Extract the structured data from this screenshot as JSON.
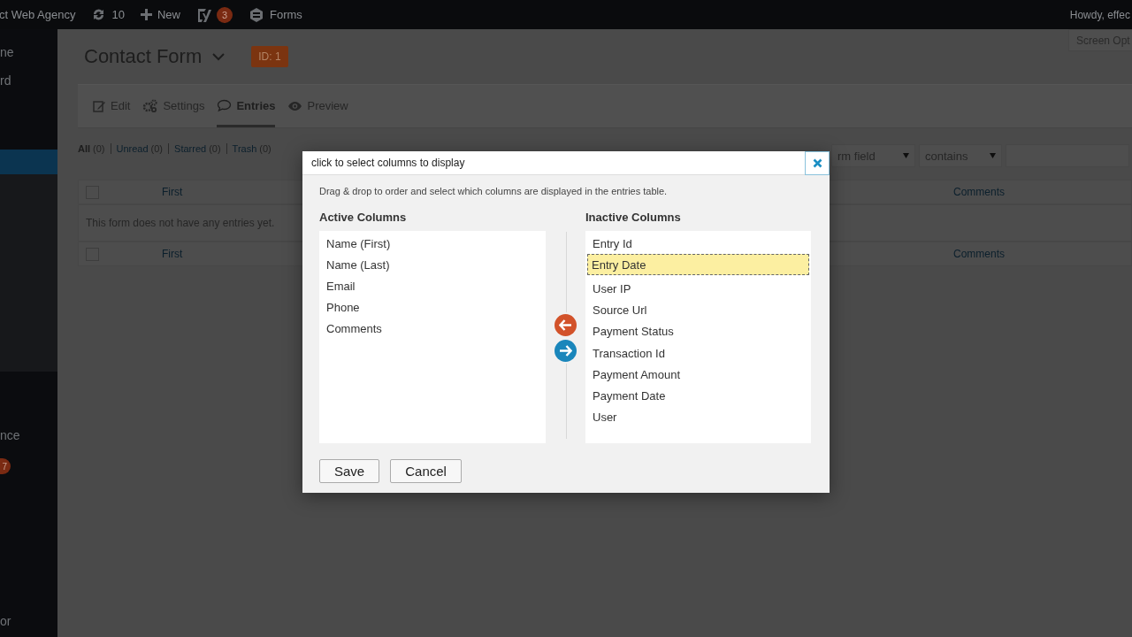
{
  "admin_bar": {
    "site": "ct Web Agency",
    "updates": "10",
    "new": "New",
    "seo_badge": "3",
    "forms": "Forms",
    "greeting": "Howdy, effec"
  },
  "sidebar": {
    "items": [
      {
        "kind": "text",
        "label": "ne"
      },
      {
        "kind": "text",
        "label": "rd"
      },
      {
        "kind": "current",
        "selected": true
      },
      {
        "kind": "submenu"
      },
      {
        "kind": "text",
        "label": "nce"
      },
      {
        "kind": "badge",
        "label": "7"
      },
      {
        "kind": "text",
        "label": "or"
      }
    ]
  },
  "screen_options": "Screen Opt",
  "page": {
    "title": "Contact Form",
    "id_badge": "ID: 1"
  },
  "tabs": [
    {
      "label": "Edit",
      "selected": false
    },
    {
      "label": "Settings",
      "selected": false
    },
    {
      "label": "Entries",
      "selected": true
    },
    {
      "label": "Preview",
      "selected": false
    }
  ],
  "filters": [
    {
      "label": "All",
      "count": "(0)",
      "selected": true
    },
    {
      "label": "Unread",
      "count": "(0)",
      "selected": false
    },
    {
      "label": "Starred",
      "count": "(0)",
      "selected": false
    },
    {
      "label": "Trash",
      "count": "(0)",
      "selected": false
    }
  ],
  "search": {
    "field": "rm field",
    "operator": "contains"
  },
  "table": {
    "header": {
      "checked": false,
      "columns": [
        "First",
        "Comments"
      ]
    },
    "empty_message": "This form does not have any entries yet.",
    "footer": {
      "checked": false,
      "columns": [
        "First",
        "Comments"
      ]
    }
  },
  "dialog": {
    "title": "click to select columns to display",
    "description": "Drag & drop to order and select which columns are displayed in the entries table.",
    "active_heading": "Active Columns",
    "inactive_heading": "Inactive Columns",
    "active_columns": [
      {
        "label": "Name (First)",
        "selected": false
      },
      {
        "label": "Name (Last)",
        "selected": false
      },
      {
        "label": "Email",
        "selected": false
      },
      {
        "label": "Phone",
        "selected": false
      },
      {
        "label": "Comments",
        "selected": false
      }
    ],
    "inactive_columns": [
      {
        "label": "Entry Id",
        "selected": false
      },
      {
        "label": "Entry Date",
        "selected": true
      },
      {
        "label": "User IP",
        "selected": false
      },
      {
        "label": "Source Url",
        "selected": false
      },
      {
        "label": "Payment Status",
        "selected": false
      },
      {
        "label": "Transaction Id",
        "selected": false
      },
      {
        "label": "Payment Amount",
        "selected": false
      },
      {
        "label": "Payment Date",
        "selected": false
      },
      {
        "label": "User",
        "selected": false
      }
    ],
    "buttons": [
      "Save",
      "Cancel"
    ]
  }
}
